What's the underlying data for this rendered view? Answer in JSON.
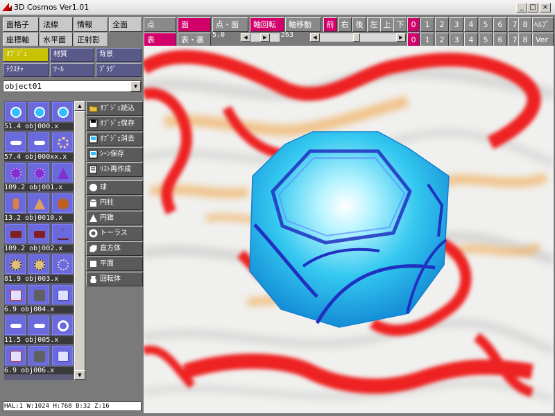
{
  "window": {
    "title": "3D Cosmos Ver1.01",
    "btn_min": "_",
    "btn_max": "□",
    "btn_close": "×"
  },
  "toolbar": {
    "row1": [
      "面格子",
      "法線",
      "情報",
      "全面",
      "点",
      "面",
      "点・面",
      "軸回転",
      "軸移動",
      "前",
      "右",
      "後",
      "左",
      "上",
      "下"
    ],
    "row2": [
      "座標軸",
      "水平面",
      "正射影",
      "表",
      "表・裏"
    ],
    "row1_nums": [
      "0",
      "1",
      "2",
      "3",
      "4",
      "5",
      "6",
      "7",
      "8"
    ],
    "row1_help": "ﾍﾙﾌﾟ",
    "row2_nums": [
      "0",
      "1",
      "2",
      "3",
      "4",
      "5",
      "6",
      "7",
      "8"
    ],
    "row2_ver": "Ver",
    "slider_left_value": "5.0",
    "slider_value": "263"
  },
  "panel": {
    "tabs": [
      "ｵﾌﾞｼﾞｪ",
      "材質",
      "背景",
      "ﾃｸｽﾁｬ",
      "ﾂｰﾙ",
      "ﾌﾟﾗｸﾞ"
    ],
    "selected_object": "object01",
    "thumbnails": [
      {
        "label": "51.4  obj000.x"
      },
      {
        "label": "57.4  obj000xx.x"
      },
      {
        "label": "109.2 obj001.x"
      },
      {
        "label": "13.2  obj0010.x"
      },
      {
        "label": "109.2 obj002.x"
      },
      {
        "label": "81.9  obj003.x"
      },
      {
        "label": "6.9   obj004.x"
      },
      {
        "label": "11.5  obj005.x"
      },
      {
        "label": "6.9   obj006.x"
      }
    ],
    "commands": [
      "ｵﾌﾞｼﾞｪ読込",
      "ｵﾌﾞｼﾞｪ保存",
      "ｵﾌﾞｼﾞｪ消去",
      "ｼｰﾝ保存",
      "ﾘｽﾄ再作成",
      "球",
      "円柱",
      "円錐",
      "トーラス",
      "直方体",
      "平面",
      "回転体"
    ],
    "status": "HAL:1 W:1024 H:768 B:32 Z:16"
  },
  "colors": {
    "accent": "#d1006a",
    "tab_selected": "#c8c200",
    "object": "#3fc8f0",
    "object_line": "#2030c0"
  }
}
